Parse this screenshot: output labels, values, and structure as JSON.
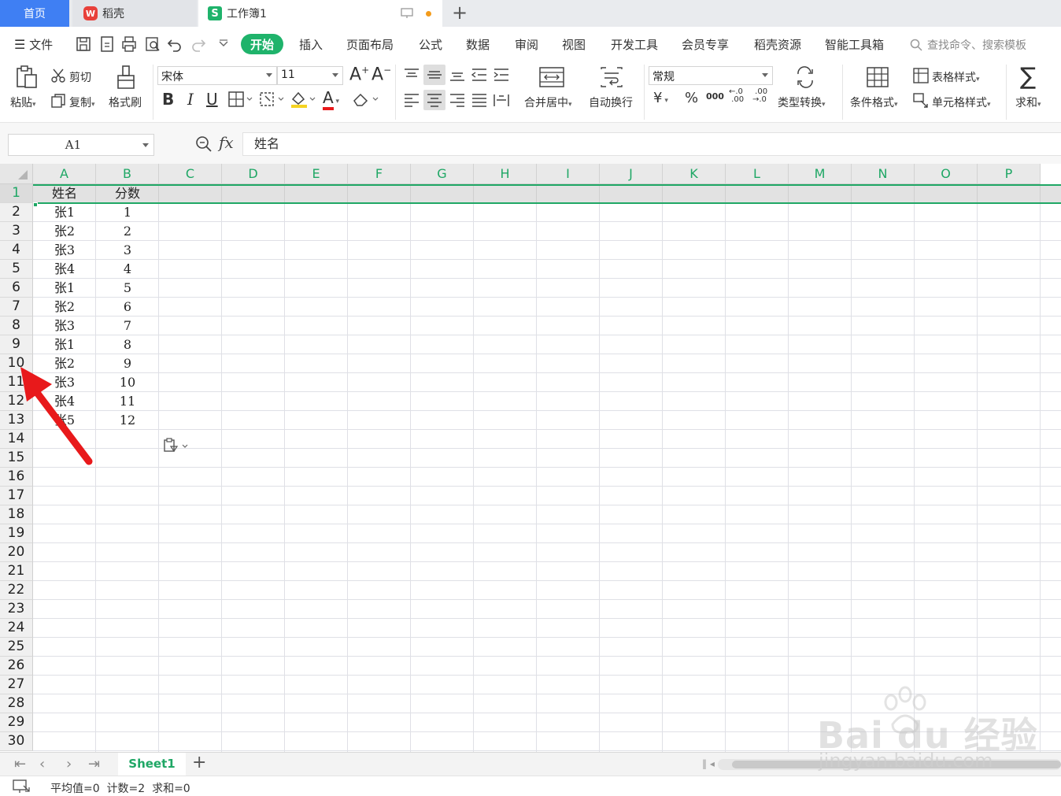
{
  "tabs": {
    "home": "首页",
    "daoke": "稻壳",
    "workbook": "工作簿1",
    "daoke_logo": "W",
    "book_logo": "S"
  },
  "menu": {
    "file": "文件",
    "start": "开始",
    "insert": "插入",
    "layout": "页面布局",
    "formula": "公式",
    "data": "数据",
    "review": "审阅",
    "view": "视图",
    "dev": "开发工具",
    "member": "会员专享",
    "resources": "稻壳资源",
    "toolbox": "智能工具箱",
    "search_placeholder": "查找命令、搜索模板"
  },
  "ribbon": {
    "paste": "粘贴",
    "cut": "剪切",
    "copy": "复制",
    "format_painter": "格式刷",
    "font_name": "宋体",
    "font_size": "11",
    "merge_center": "合并居中",
    "wrap_text": "自动换行",
    "number_format": "常规",
    "type_convert": "类型转换",
    "cond_format": "条件格式",
    "table_style": "表格样式",
    "cell_style": "单元格样式",
    "sum": "求和",
    "bold": "B",
    "italic": "I",
    "underline": "U",
    "font_color_glyph": "A",
    "currency": "¥",
    "percent": "%",
    "thousands": "000"
  },
  "formula_bar": {
    "name_box": "A1",
    "fx": "fx",
    "content": "姓名"
  },
  "columns": [
    "A",
    "B",
    "C",
    "D",
    "E",
    "F",
    "G",
    "H",
    "I",
    "J",
    "K",
    "L",
    "M",
    "N",
    "O",
    "P"
  ],
  "rows": [
    "1",
    "2",
    "3",
    "4",
    "5",
    "6",
    "7",
    "8",
    "9",
    "10",
    "11",
    "12",
    "13",
    "14",
    "15",
    "16",
    "17",
    "18",
    "19",
    "20",
    "21",
    "22",
    "23",
    "24",
    "25",
    "26",
    "27",
    "28",
    "29",
    "30"
  ],
  "table": {
    "headers": [
      "姓名",
      "分数"
    ],
    "rows": [
      [
        "张1",
        "1"
      ],
      [
        "张2",
        "2"
      ],
      [
        "张3",
        "3"
      ],
      [
        "张4",
        "4"
      ],
      [
        "张1",
        "5"
      ],
      [
        "张2",
        "6"
      ],
      [
        "张3",
        "7"
      ],
      [
        "张1",
        "8"
      ],
      [
        "张2",
        "9"
      ],
      [
        "张3",
        "10"
      ],
      [
        "张4",
        "11"
      ],
      [
        "张5",
        "12"
      ]
    ]
  },
  "sheet": {
    "name": "Sheet1"
  },
  "status": {
    "text": "平均值=0  计数=2  求和=0"
  },
  "watermark": {
    "logo": "Bai du 经验",
    "url": "jingyan.baidu.com"
  },
  "colors": {
    "accent_green": "#1fb36b",
    "home_tab_blue": "#3f7ff3",
    "arrow_red": "#e8191b"
  }
}
